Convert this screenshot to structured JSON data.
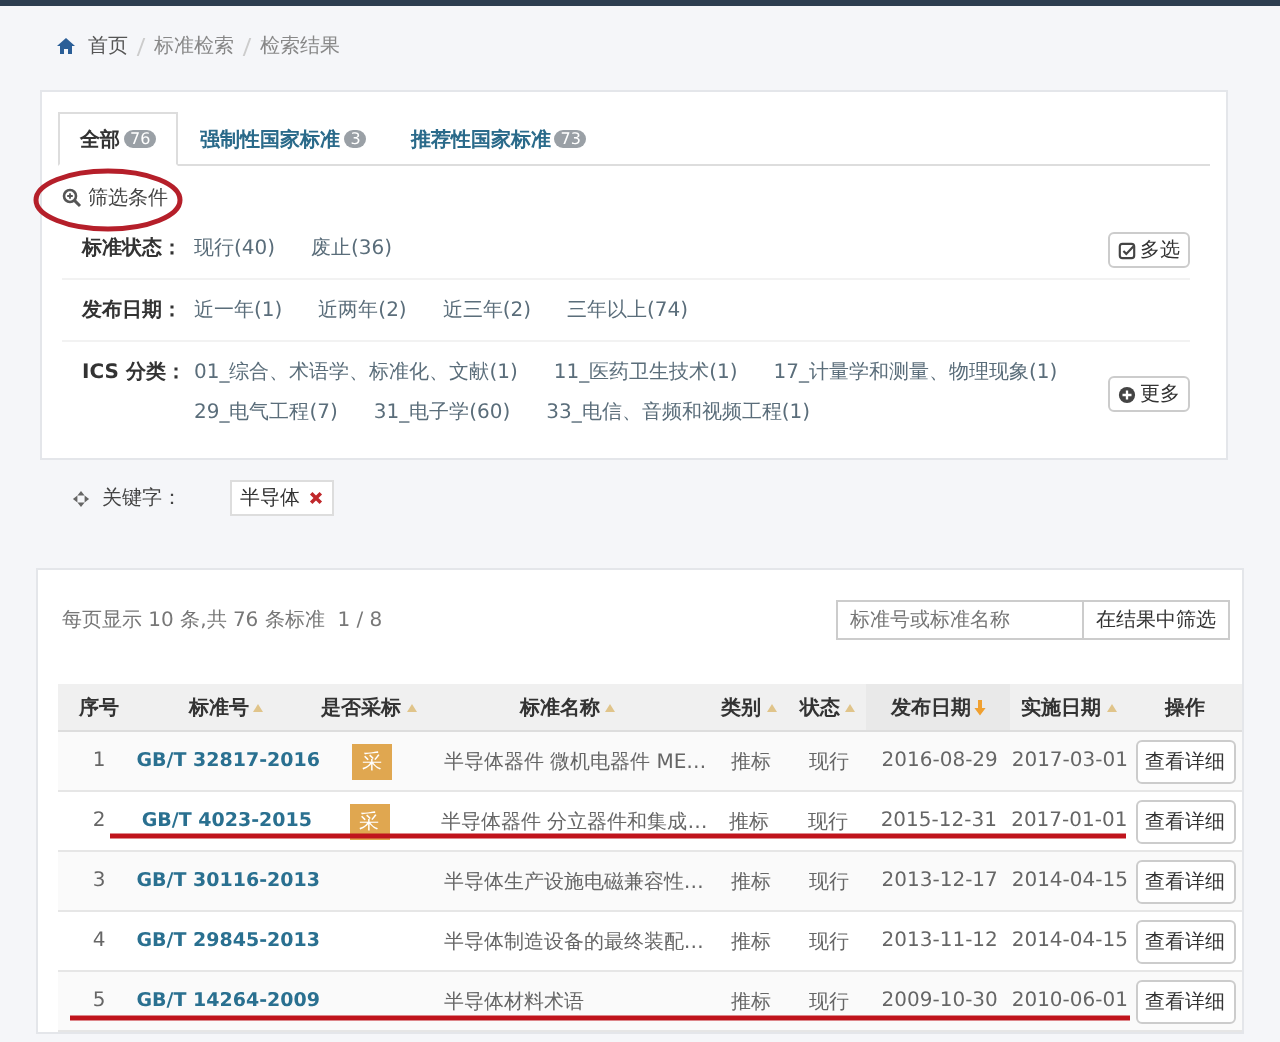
{
  "breadcrumb": [
    "首页",
    "标准检索",
    "检索结果"
  ],
  "tabs": [
    {
      "label": "全部",
      "count": "76",
      "selected": true
    },
    {
      "label": "强制性国家标准",
      "count": "3",
      "selected": false
    },
    {
      "label": "推荐性国家标准",
      "count": "73",
      "selected": false
    }
  ],
  "filter": {
    "title": "筛选条件",
    "groups": [
      {
        "label": "标准状态：",
        "options": [
          "现行(40)",
          "废止(36)"
        ],
        "action": {
          "kind": "multi",
          "label": "多选"
        }
      },
      {
        "label": "发布日期：",
        "options": [
          "近一年(1)",
          "近两年(2)",
          "近三年(2)",
          "三年以上(74)"
        ]
      },
      {
        "label": "ICS 分类：",
        "options": [
          "01_综合、术语学、标准化、文献(1)",
          "11_医药卫生技术(1)",
          "17_计量学和测量、物理现象(1)",
          "29_电气工程(7)",
          "31_电子学(60)",
          "33_电信、音频和视频工程(1)"
        ],
        "action": {
          "kind": "more",
          "label": "更多"
        }
      }
    ]
  },
  "keyword": {
    "label": "关键字：",
    "tags": [
      "半导体"
    ]
  },
  "results": {
    "summary": "每页显示 10 条,共 76 条标准  1 / 8",
    "search_placeholder": "标准号或标准名称",
    "search_button": "在结果中筛选",
    "columns": [
      {
        "label": "序号",
        "sortable": false
      },
      {
        "label": "标准号",
        "sortable": true,
        "active": false
      },
      {
        "label": "是否采标",
        "sortable": true,
        "active": false
      },
      {
        "label": "标准名称",
        "sortable": true,
        "active": false
      },
      {
        "label": "类别",
        "sortable": true,
        "active": false
      },
      {
        "label": "状态",
        "sortable": true,
        "active": false
      },
      {
        "label": "发布日期",
        "sortable": true,
        "active": true
      },
      {
        "label": "实施日期",
        "sortable": true,
        "active": false
      },
      {
        "label": "操作",
        "sortable": false
      }
    ],
    "rows": [
      {
        "no": "1",
        "code": "GB/T 32817-2016",
        "badge": "采",
        "name": "半导体器件 微机电器件 ME…",
        "category": "推标",
        "status": "现行",
        "published": "2016-08-29",
        "effective": "2017-03-01",
        "action": "查看详细"
      },
      {
        "no": "2",
        "code": "GB/T 4023-2015",
        "badge": "采",
        "name": "半导体器件 分立器件和集成…",
        "category": "推标",
        "status": "现行",
        "published": "2015-12-31",
        "effective": "2017-01-01",
        "action": "查看详细"
      },
      {
        "no": "3",
        "code": "GB/T 30116-2013",
        "name": "半导体生产设施电磁兼容性…",
        "category": "推标",
        "status": "现行",
        "published": "2013-12-17",
        "effective": "2014-04-15",
        "action": "查看详细"
      },
      {
        "no": "4",
        "code": "GB/T 29845-2013",
        "name": "半导体制造设备的最终装配…",
        "category": "推标",
        "status": "现行",
        "published": "2013-11-12",
        "effective": "2014-04-15",
        "action": "查看详细"
      },
      {
        "no": "5",
        "code": "GB/T 14264-2009",
        "name": "半导体材料术语",
        "category": "推标",
        "status": "现行",
        "published": "2009-10-30",
        "effective": "2010-06-01",
        "action": "查看详细"
      }
    ]
  }
}
